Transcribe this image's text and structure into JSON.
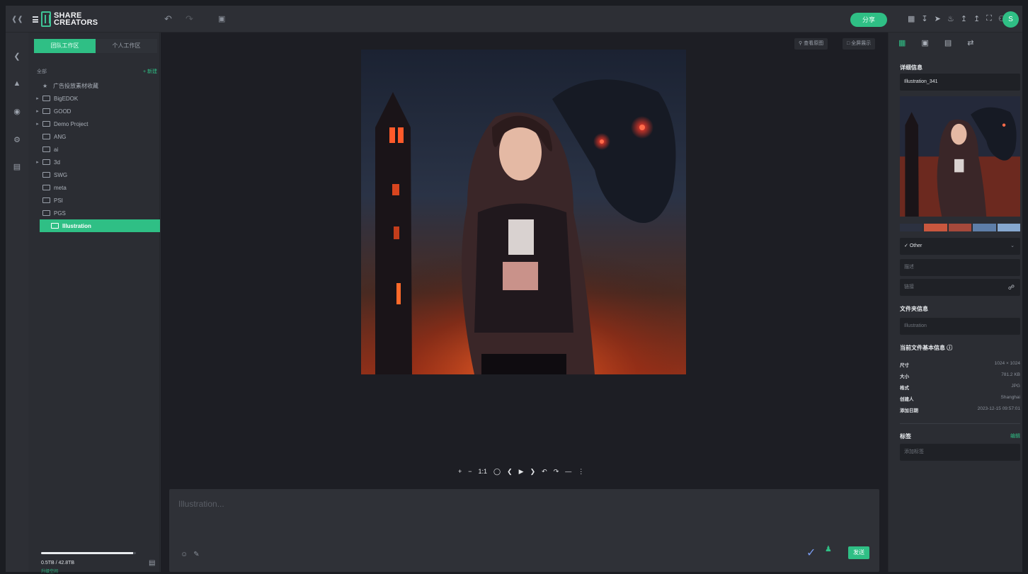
{
  "topbar": {
    "brand_line1": "SHARE",
    "brand_line2": "CREATORS",
    "share_label": "分享",
    "avatar_initial": "S"
  },
  "sidebar": {
    "tab_team": "团队工作区",
    "tab_personal": "个人工作区",
    "tree_header": "全部",
    "add_label": "+ 新建",
    "items": [
      {
        "label": "广告投放素材收藏",
        "type": "pin",
        "expand": false
      },
      {
        "label": "BigEDOK",
        "type": "folder",
        "expand": true
      },
      {
        "label": "GOOD",
        "type": "folder",
        "expand": true
      },
      {
        "label": "Demo Project",
        "type": "folder",
        "expand": true
      },
      {
        "label": "ANG",
        "type": "folder",
        "expand": false
      },
      {
        "label": "ai",
        "type": "folder",
        "expand": false
      },
      {
        "label": "3d",
        "type": "folder",
        "expand": true
      },
      {
        "label": "SWG",
        "type": "folder",
        "expand": false
      },
      {
        "label": "meta",
        "type": "folder",
        "expand": false
      },
      {
        "label": "PSI",
        "type": "folder",
        "expand": false
      },
      {
        "label": "PGS",
        "type": "folder",
        "expand": false
      },
      {
        "label": "Illustration",
        "type": "folder",
        "expand": false
      }
    ],
    "storage_text": "0.5TB / 42.8TB",
    "storage_sub": "升级空间",
    "storage_fraction": 0.97
  },
  "viewer": {
    "btn_original": "查看原图",
    "btn_fullscreen": "全屏展示",
    "comment_placeholder": "Illustration...",
    "send_label": "发送"
  },
  "panel": {
    "section_details": "详细信息",
    "file_name": "Illustration_341",
    "palette": [
      "#2c3140",
      "#c9573e",
      "#a5493b",
      "#5e7ea8",
      "#86a8cf"
    ],
    "category": "Other",
    "desc_placeholder": "描述",
    "link_placeholder": "链接",
    "section_folder": "文件夹信息",
    "folder_value": "Illustration",
    "section_basic": "当前文件基本信息",
    "meta": [
      {
        "k": "尺寸",
        "v": "1024 × 1024"
      },
      {
        "k": "大小",
        "v": "781.2 KB"
      },
      {
        "k": "格式",
        "v": "JPG"
      },
      {
        "k": "创建人",
        "v": "Shanghai"
      },
      {
        "k": "添加日期",
        "v": "2023-12-15 09:57:01"
      }
    ],
    "section_tags": "标签",
    "tags_edit": "编辑",
    "tags_placeholder": "添加标签"
  }
}
